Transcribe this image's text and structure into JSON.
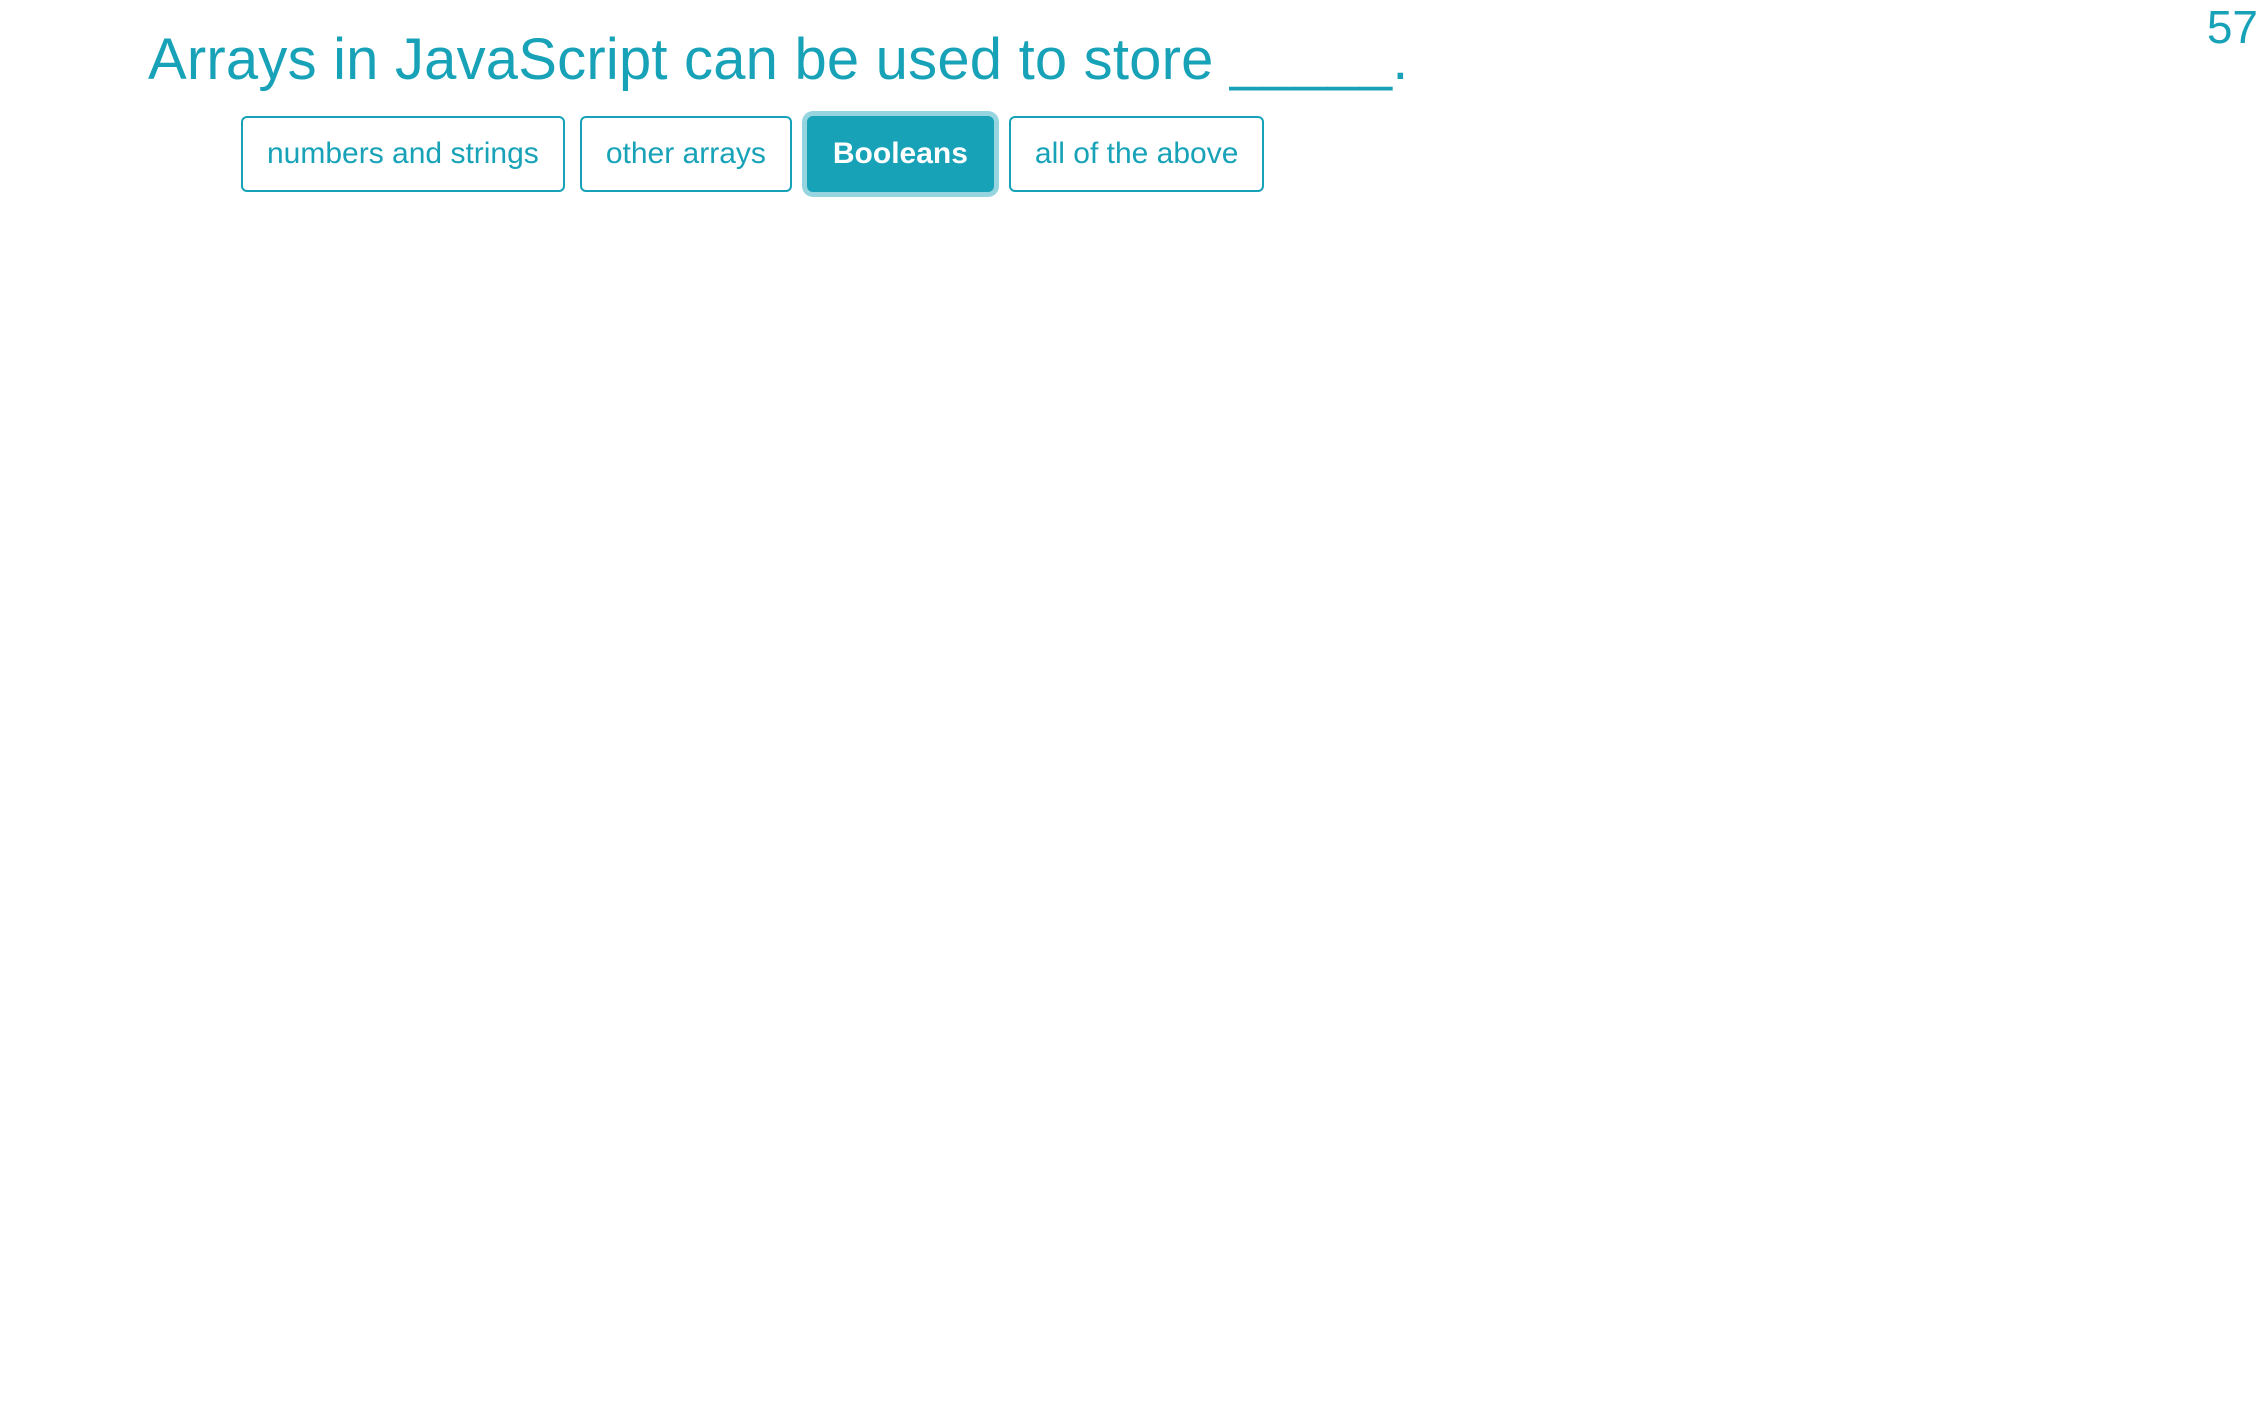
{
  "question": {
    "text": "Arrays in JavaScript can be used to store _____."
  },
  "counter": {
    "value": "57"
  },
  "options": [
    {
      "label": "numbers and strings",
      "selected": false
    },
    {
      "label": "other arrays",
      "selected": false
    },
    {
      "label": "Booleans",
      "selected": true
    },
    {
      "label": "all of the above",
      "selected": false
    }
  ],
  "colors": {
    "accent": "#17a2b8",
    "background": "#ffffff",
    "selected_text": "#ffffff"
  }
}
